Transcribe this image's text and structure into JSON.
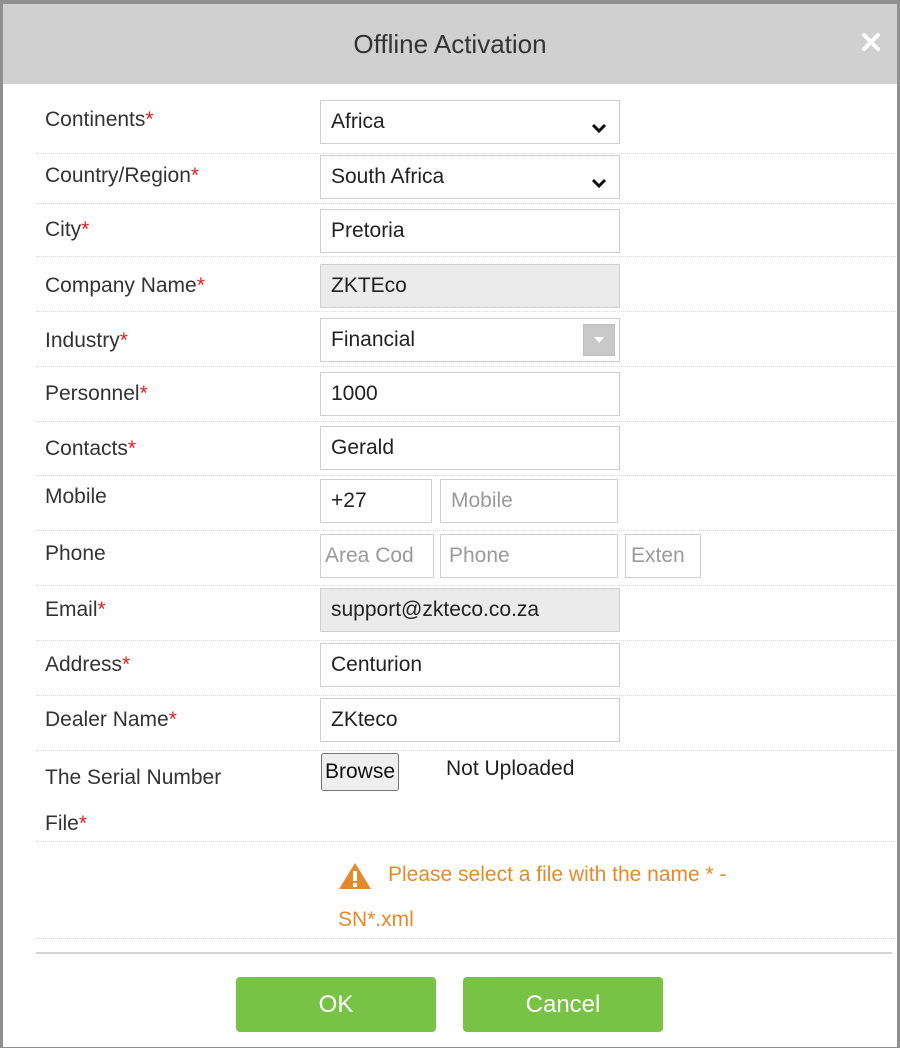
{
  "dialog": {
    "title": "Offline Activation",
    "close_glyph": "×"
  },
  "form": {
    "required_mark": "*",
    "continents": {
      "label": "Continents",
      "value": "Africa"
    },
    "country": {
      "label": "Country/Region",
      "value": "South Africa"
    },
    "city": {
      "label": "City",
      "value": "Pretoria"
    },
    "company": {
      "label": "Company Name",
      "value": "ZKTEco"
    },
    "industry": {
      "label": "Industry",
      "value": "Financial"
    },
    "personnel": {
      "label": "Personnel",
      "value": "1000"
    },
    "contacts": {
      "label": "Contacts",
      "value": "Gerald"
    },
    "mobile": {
      "label": "Mobile",
      "code": "+27",
      "placeholder": "Mobile"
    },
    "phone": {
      "label": "Phone",
      "area_placeholder": "Area Cod",
      "phone_placeholder": "Phone",
      "ext_placeholder": "Exten"
    },
    "email": {
      "label": "Email",
      "value": "support@zkteco.co.za"
    },
    "address": {
      "label": "Address",
      "value": "Centurion"
    },
    "dealer": {
      "label": "Dealer Name",
      "value": "ZKteco"
    },
    "serial": {
      "label_line1": "The Serial Number",
      "label_line2": "File",
      "browse_label": "Browse",
      "status": "Not Uploaded"
    },
    "warning": "Please select a file with the name * - SN*.xml"
  },
  "buttons": {
    "ok": "OK",
    "cancel": "Cancel"
  },
  "colors": {
    "title_bar": "#d0d0d0",
    "required": "#e02020",
    "warning": "#e58a2a",
    "button_green": "#78c346"
  }
}
